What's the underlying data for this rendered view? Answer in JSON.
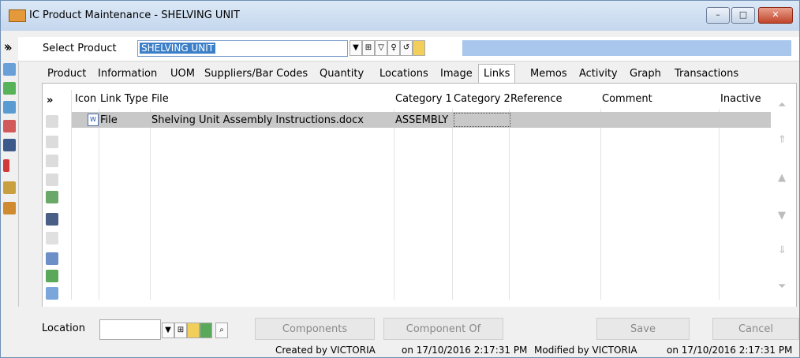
{
  "window": {
    "title": "IC Product Maintenance - SHELVING UNIT",
    "controls": {
      "minimize": "–",
      "maximize": "□",
      "close": "✕"
    }
  },
  "select_product": {
    "label": "Select Product",
    "value": "SHELVING UNIT"
  },
  "tabs": [
    {
      "label": "Product"
    },
    {
      "label": "Information"
    },
    {
      "label": "UOM"
    },
    {
      "label": "Suppliers/Bar Codes"
    },
    {
      "label": "Quantity"
    },
    {
      "label": "Locations"
    },
    {
      "label": "Image"
    },
    {
      "label": "Links"
    },
    {
      "label": "Memos"
    },
    {
      "label": "Activity"
    },
    {
      "label": "Graph"
    },
    {
      "label": "Transactions"
    }
  ],
  "active_tab": "Links",
  "links_table": {
    "columns": [
      "Icon",
      "Link Type",
      "File",
      "Category 1",
      "Category 2",
      "Reference",
      "Comment",
      "Inactive"
    ],
    "rows": [
      {
        "icon": "word-document-icon",
        "link_type": "File",
        "file": "Shelving Unit Assembly Instructions.docx",
        "category1": "ASSEMBLY",
        "category2": "",
        "reference": "",
        "comment": "",
        "inactive": ""
      }
    ]
  },
  "bottom": {
    "location_label": "Location",
    "location_value": "",
    "components_label": "Components",
    "component_of_label": "Component Of",
    "save_label": "Save",
    "cancel_label": "Cancel"
  },
  "status": {
    "created": "Created by VICTORIA",
    "created_on": "on 17/10/2016 2:17:31 PM",
    "modified": "Modified by VICTORIA",
    "modified_on": "on 17/10/2016 2:17:31 PM"
  },
  "colors": {
    "title_bar": "#c5d7ee",
    "selection": "#3c7fc8",
    "row_highlight": "#c8c8c8"
  }
}
